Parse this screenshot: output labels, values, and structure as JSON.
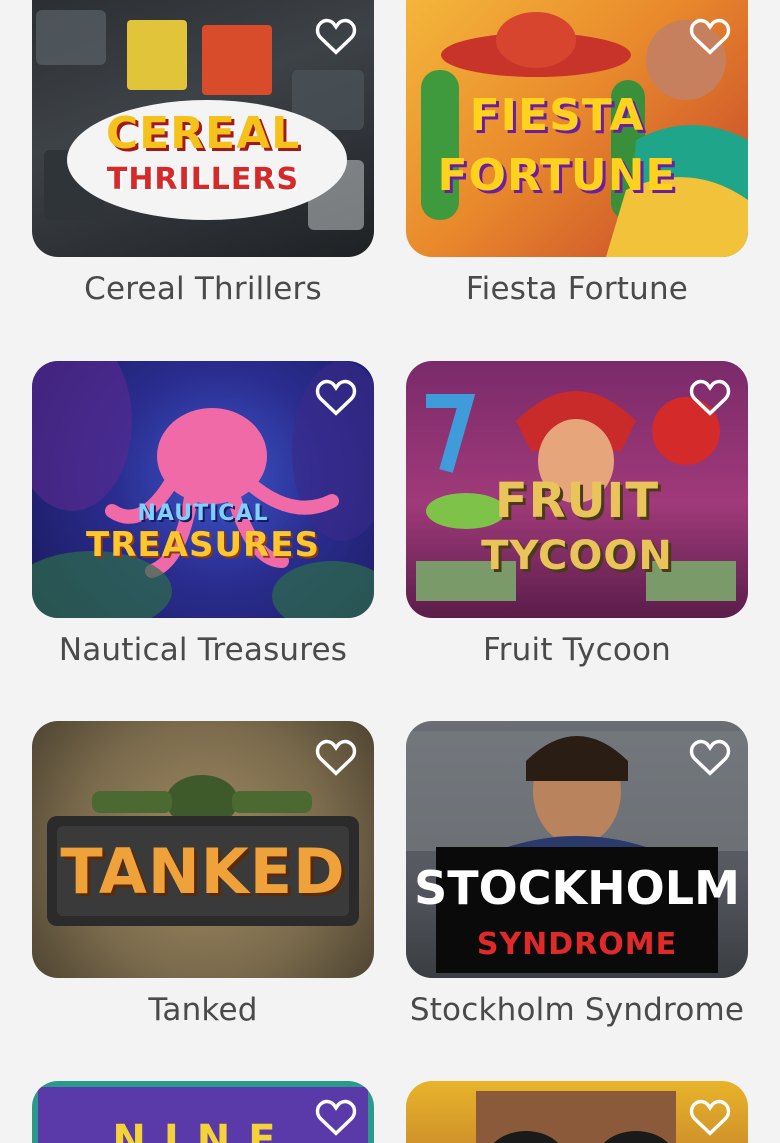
{
  "games": [
    {
      "title": "Cereal Thrillers",
      "logo_lines": [
        "CEREAL",
        "THRILLERS"
      ]
    },
    {
      "title": "Fiesta Fortune",
      "logo_lines": [
        "FIESTA",
        "FORTUNE"
      ]
    },
    {
      "title": "Nautical Treasures",
      "logo_lines": [
        "NAUTICAL",
        "TREASURES"
      ]
    },
    {
      "title": "Fruit Tycoon",
      "logo_lines": [
        "FRUIT",
        "TYCOON"
      ]
    },
    {
      "title": "Tanked",
      "logo_lines": [
        "TANKED"
      ]
    },
    {
      "title": "Stockholm Syndrome",
      "logo_lines": [
        "STOCKHOLM",
        "SYNDROME"
      ]
    },
    {
      "title": "",
      "logo_lines": [
        "NINE"
      ]
    },
    {
      "title": "",
      "logo_lines": []
    }
  ],
  "icons": {
    "favorite": "heart-outline-icon"
  },
  "colors": {
    "page_background": "#f3f3f3",
    "title_text": "#4a4a4a",
    "heart_stroke": "#ffffff"
  }
}
